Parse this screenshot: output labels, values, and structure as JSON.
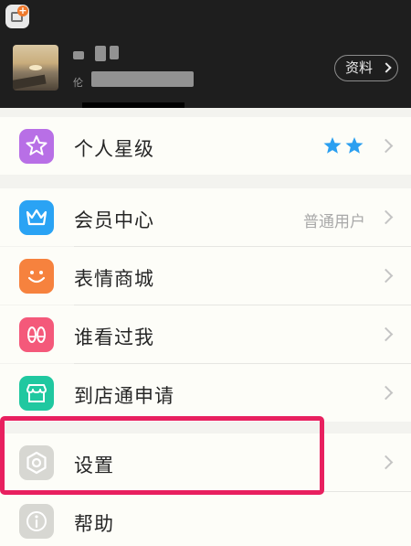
{
  "header": {
    "profile_button": "资料",
    "name_fragment": "伦"
  },
  "menu": {
    "level": {
      "label": "个人星级",
      "stars": 2,
      "icon": "star-icon",
      "color": "#b86fe6"
    },
    "vip": {
      "label": "会员中心",
      "status": "普通用户",
      "icon": "crown-icon",
      "color": "#2aa3f4"
    },
    "emoji": {
      "label": "表情商城",
      "icon": "smile-icon",
      "color": "#f6823e"
    },
    "visitors": {
      "label": "谁看过我",
      "icon": "footprints-icon",
      "color": "#f4597a"
    },
    "store": {
      "label": "到店通申请",
      "icon": "store-icon",
      "color": "#20c8a0"
    },
    "settings": {
      "label": "设置",
      "icon": "gear-icon",
      "color": "#d7d7d2"
    },
    "help": {
      "label": "帮助",
      "icon": "info-icon",
      "color": "#d7d7d2"
    }
  },
  "colors": {
    "highlight": "#e8205f",
    "star": "#2b9ff0"
  }
}
